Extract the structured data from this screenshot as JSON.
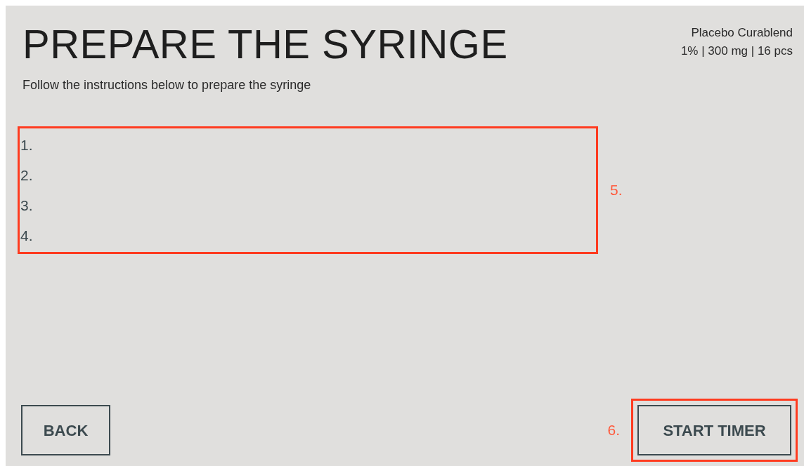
{
  "header": {
    "title": "PREPARE THE SYRINGE",
    "subtitle": "Follow the instructions below to prepare the syringe"
  },
  "product": {
    "name": "Placebo Curablend",
    "details": "1% | 300 mg | 16 pcs"
  },
  "steps": [
    "1.",
    "2.",
    "3.",
    "4."
  ],
  "annotations": {
    "steps": "5.",
    "start_button": "6."
  },
  "buttons": {
    "back": "BACK",
    "start": "START TIMER"
  }
}
